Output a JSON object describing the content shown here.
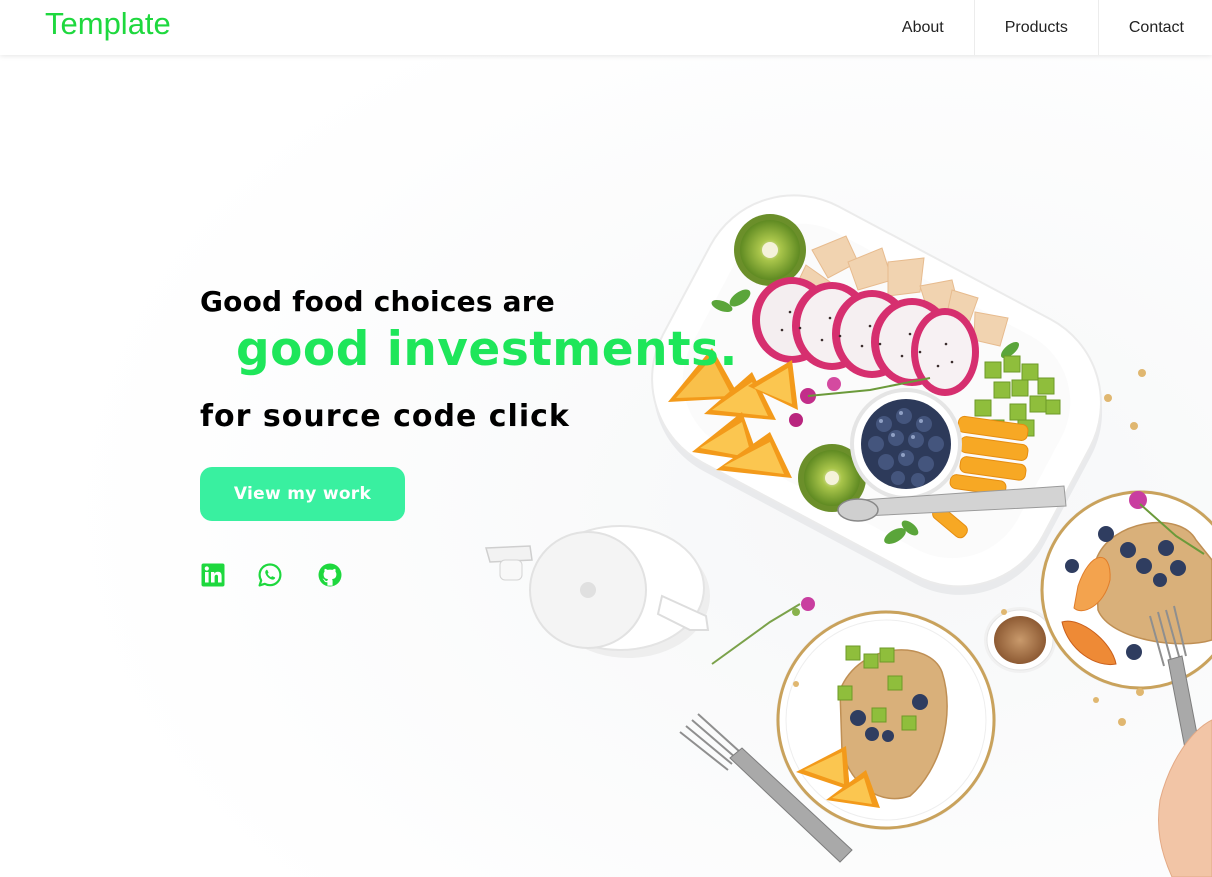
{
  "header": {
    "brand": "Template",
    "nav": [
      {
        "label": "About"
      },
      {
        "label": "Products"
      },
      {
        "label": "Contact"
      }
    ]
  },
  "hero": {
    "line1": "Good food choices are",
    "line2": "good investments.",
    "line3": "for source code click",
    "cta_label": "View my work",
    "social": [
      {
        "icon": "linkedin-icon"
      },
      {
        "icon": "whatsapp-icon"
      },
      {
        "icon": "github-icon"
      }
    ]
  },
  "colors": {
    "brand_green": "#1ed83e",
    "headline_green": "#1ee65a",
    "button_mint": "#39f0a0",
    "icon_green": "#1ed83e"
  }
}
